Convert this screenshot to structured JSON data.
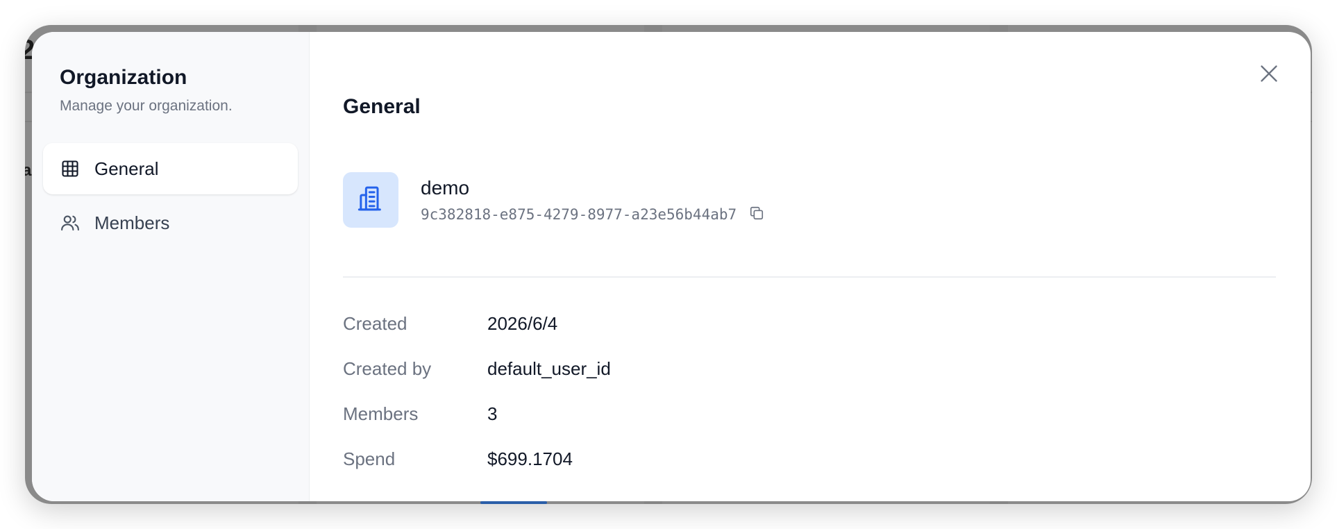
{
  "background": {
    "fragments": [
      "2",
      "a"
    ]
  },
  "sidebar": {
    "title": "Organization",
    "subtitle": "Manage your organization.",
    "items": [
      {
        "label": "General",
        "icon": "grid-icon",
        "active": true
      },
      {
        "label": "Members",
        "icon": "users-icon",
        "active": false
      }
    ]
  },
  "main": {
    "title": "General",
    "org": {
      "name": "demo",
      "id": "9c382818-e875-4279-8977-a23e56b44ab7",
      "avatar_icon": "building-icon"
    },
    "details": [
      {
        "label": "Created",
        "value": "2026/6/4"
      },
      {
        "label": "Created by",
        "value": "default_user_id"
      },
      {
        "label": "Members",
        "value": "3"
      },
      {
        "label": "Spend",
        "value": "$699.1704"
      }
    ]
  },
  "colors": {
    "accent": "#2563eb",
    "avatar_bg": "#d7e6fd",
    "sidebar_bg": "#f8f9fb",
    "muted_text": "#6b7280"
  }
}
